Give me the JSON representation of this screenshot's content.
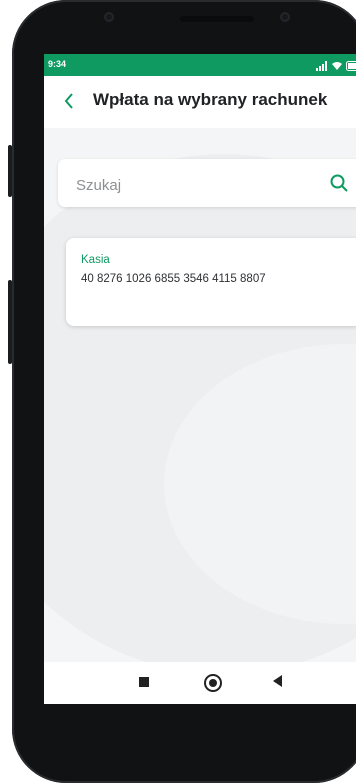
{
  "status_bar": {
    "time": "9:34",
    "icons": [
      "signal-icon",
      "wifi-icon",
      "battery-icon"
    ]
  },
  "header": {
    "title": "Wpłata na wybrany rachunek",
    "back_icon": "chevron-left-icon"
  },
  "search": {
    "placeholder": "Szukaj",
    "value": ""
  },
  "accounts": [
    {
      "name": "Kasia",
      "number": "40 8276 1026 6855 3546 4115 8807"
    }
  ],
  "colors": {
    "accent": "#0f9a61",
    "background": "#f4f5f6",
    "card": "#ffffff",
    "text": "#202225"
  }
}
